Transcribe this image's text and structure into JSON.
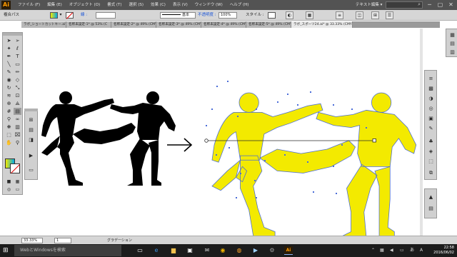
{
  "app": {
    "logo": "Ai"
  },
  "menubar": {
    "items": [
      "ファイル (F)",
      "編集 (E)",
      "オブジェクト (O)",
      "書式 (T)",
      "選択 (S)",
      "効果 (C)",
      "表示 (V)",
      "ウィンドウ (W)",
      "ヘルプ (H)"
    ],
    "workspace": "テキスト編集 ▾",
    "window_controls": [
      "─",
      "▢",
      "✕"
    ]
  },
  "controlbar": {
    "selection_label": "複合パス",
    "stroke_label": "線 :",
    "brush_label": "基本",
    "opacity_label": "不透明度 :",
    "opacity_value": "100%",
    "style_label": "スタイル :"
  },
  "tabs": [
    "ラボ_ショートカットキー.ai* @ 83%",
    "名称未設定-1* @ 53% (C",
    "名称未設定-2* @ 49% (CMYK/",
    "名称未設定-3* @ 49% (CMYK/",
    "名称未設定-4* @ 49% (CMYK/",
    "名称未設定-5* @ 49% (CMYK/",
    "ラボ_スポーツ24.ai* @ 33.33% (CMYK/プレビュー)"
  ],
  "statusbar": {
    "zoom": "33.33%",
    "page": "1",
    "tool": "グラデーション"
  },
  "taskbar": {
    "search_placeholder": "WebとWindowsを検索",
    "time": "22:58",
    "date": "2016/06/02"
  },
  "colors": {
    "gradient_start": "#f3ea00",
    "gradient_end": "#00a8e8",
    "anchor_points": "#4a6cd8",
    "menubar_bg": "#535353",
    "panel_bg": "#d0d0d0"
  },
  "icons": {
    "tools": [
      "selection-tool-icon",
      "direct-selection-tool-icon",
      "magic-wand-tool-icon",
      "lasso-tool-icon",
      "pen-tool-icon",
      "type-tool-icon",
      "line-tool-icon",
      "rectangle-tool-icon",
      "paintbrush-tool-icon",
      "pencil-tool-icon",
      "blob-brush-tool-icon",
      "eraser-tool-icon",
      "rotate-tool-icon",
      "scale-tool-icon",
      "width-tool-icon",
      "free-transform-tool-icon",
      "shape-builder-tool-icon",
      "perspective-grid-tool-icon",
      "mesh-tool-icon",
      "gradient-tool-icon",
      "eyedropper-tool-icon",
      "blend-tool-icon",
      "symbol-sprayer-tool-icon",
      "column-graph-tool-icon",
      "artboard-tool-icon",
      "slice-tool-icon",
      "hand-tool-icon",
      "zoom-tool-icon"
    ]
  }
}
